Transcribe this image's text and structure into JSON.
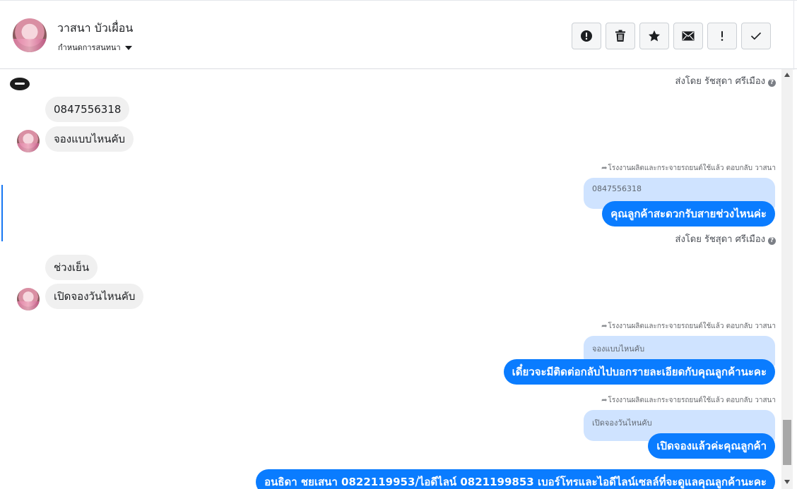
{
  "header": {
    "contact_name": "วาสนา บัวเผื่อน",
    "assign_label": "กำหนดการสนทนา",
    "actions": [
      {
        "name": "mark-spam",
        "icon": "exclamation-circle-icon"
      },
      {
        "name": "delete",
        "icon": "trash-icon"
      },
      {
        "name": "star",
        "icon": "star-icon"
      },
      {
        "name": "mark-unread",
        "icon": "envelope-icon"
      },
      {
        "name": "follow-up",
        "icon": "exclamation-icon"
      },
      {
        "name": "mark-done",
        "icon": "check-icon"
      }
    ]
  },
  "conversation": {
    "sent_by_1": "ส่งโดย รัชสุดา ศรีเมือง",
    "sent_by_2": "ส่งโดย รัชสุดา ศรีเมือง",
    "incoming_1": "0847556318",
    "incoming_2": "จองแบบไหนคับ",
    "incoming_3": "ช่วงเย็น",
    "incoming_4": "เปิดจองวันไหนคับ",
    "reply_note_1": "โรงงานผลิตและกระจายรถยนต์ใช้แล้ว ตอบกลับ วาสนา",
    "reply_note_2": "โรงงานผลิตและกระจายรถยนต์ใช้แล้ว ตอบกลับ วาสนา",
    "reply_note_3": "โรงงานผลิตและกระจายรถยนต์ใช้แล้ว ตอบกลับ วาสนา",
    "quoted_1": "0847556318",
    "quoted_2": "จองแบบไหนคับ",
    "quoted_3": "เปิดจองวันไหนคับ",
    "outgoing_1": "คุณลูกค้าสะดวกรับสายช่วงไหนค่ะ",
    "outgoing_2": "เดี๋ยวจะมีติดต่อกลับไปบอกรายละเอียดกับคุณลูกค้านะคะ",
    "outgoing_3": "เปิดจองแล้วค่ะคุณลูกค้า",
    "outgoing_4": "อนธิดา ชยเสนา 0822119953/ไอดีไลน์ 0821199853 เบอร์โทรและไอดีไลน์เซลล์ที่จะดูแลคุณลูกค้านะคะ"
  },
  "colors": {
    "outgoing_bubble": "#0a7cff",
    "quoted_bubble": "#cfe3ff",
    "incoming_bubble": "#f0f0f0",
    "accent": "#1877f2"
  }
}
